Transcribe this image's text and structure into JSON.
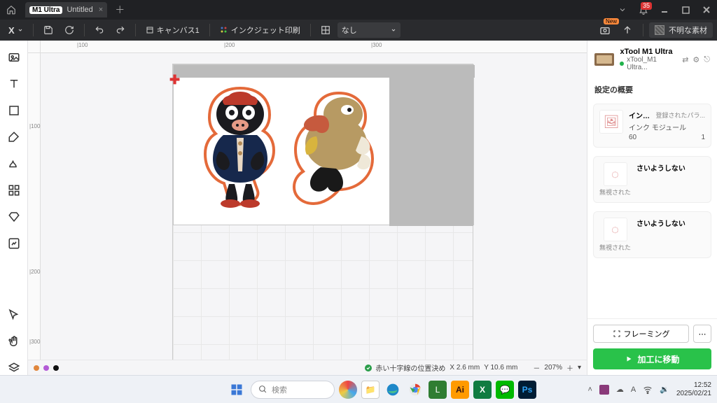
{
  "title_bar": {
    "tab_badge": "M1 Ultra",
    "tab_name": "Untitled",
    "notification_count": "35"
  },
  "toolbar": {
    "canvas_label": "キャンバス1",
    "print_mode": "インクジェット印刷",
    "none_label": "なし",
    "material_label": "不明な素材"
  },
  "rulers": {
    "h": [
      "|100",
      "|200",
      "|300"
    ],
    "v": [
      "|100",
      "|200",
      "|300"
    ]
  },
  "status": {
    "origin_label": "赤い十字線の位置決め",
    "x_label": "X 2.6 mm",
    "y_label": "Y 10.6 mm",
    "zoom": "207%"
  },
  "device": {
    "name": "xTool M1 Ultra",
    "sub": "xTool_M1 Ultra..."
  },
  "section_title": "設定の概要",
  "layers": [
    {
      "title": "インクジェッ...",
      "meta": "登録されたパラ...",
      "sub_l": "インク モジュール",
      "sub_r_left": "60",
      "sub_r_right": "1",
      "tag": ""
    },
    {
      "title": "さいようしない",
      "meta": "",
      "sub_l": "",
      "sub_r_left": "",
      "sub_r_right": "",
      "tag": "無視された"
    },
    {
      "title": "さいようしない",
      "meta": "",
      "sub_l": "",
      "sub_r_left": "",
      "sub_r_right": "",
      "tag": "無視された"
    }
  ],
  "framing_label": "フレーミング",
  "process_label": "加工に移動",
  "taskbar": {
    "search_placeholder": "検索",
    "time": "12:52",
    "date": "2025/02/21",
    "ime": "A"
  }
}
